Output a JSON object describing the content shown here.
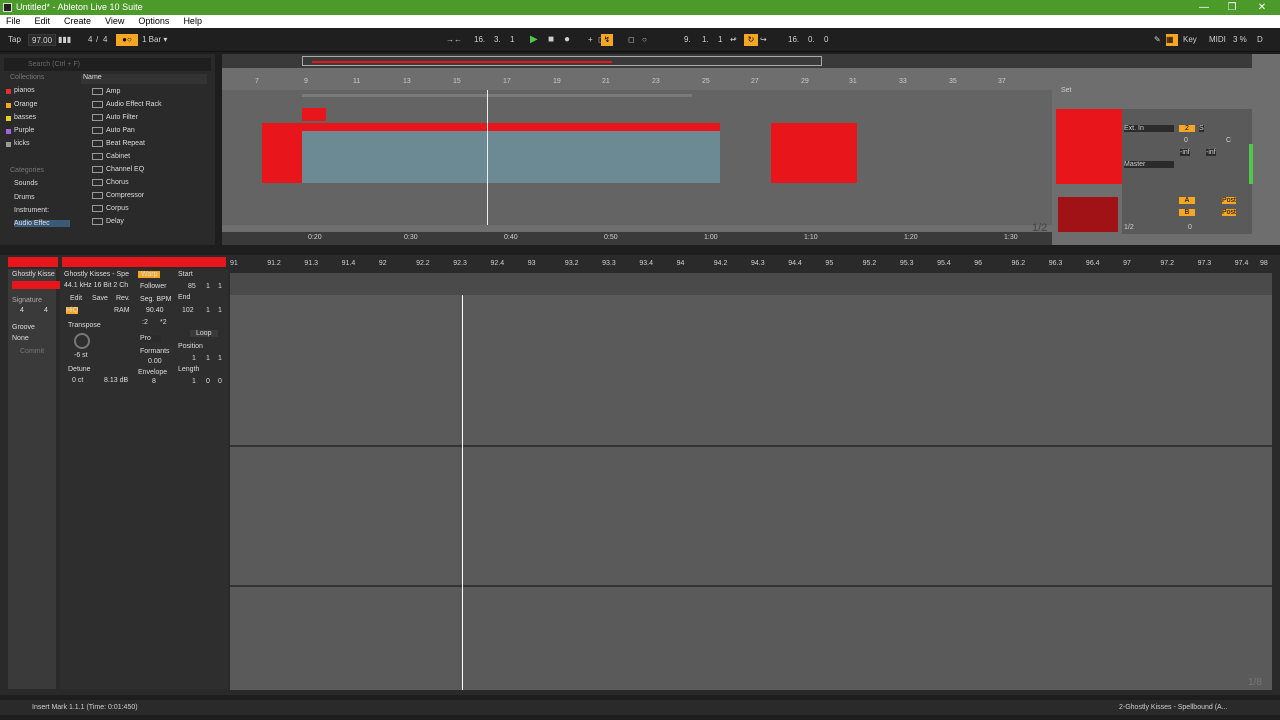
{
  "window": {
    "title": "Untitled* - Ableton Live 10 Suite"
  },
  "menu": [
    "File",
    "Edit",
    "Create",
    "View",
    "Options",
    "Help"
  ],
  "transport": {
    "tap": "Tap",
    "tempo": "97.00",
    "sig_num": "4",
    "sig_den": "4",
    "quantize": "1 Bar",
    "pos": [
      "16.",
      "3.",
      "1"
    ],
    "loop_start": [
      "9.",
      "1.",
      "1"
    ],
    "loop_len": [
      "16.",
      "0.",
      "0"
    ],
    "key": "Key",
    "midi": "MIDI",
    "cpu": "3 %",
    "disk": "D"
  },
  "browser": {
    "search_placeholder": "Search (Ctrl + F)",
    "collections_title": "Collections",
    "collections": [
      {
        "label": "pianos",
        "color": "#e03030"
      },
      {
        "label": "Orange",
        "color": "#f5a623"
      },
      {
        "label": "basses",
        "color": "#e6d21a"
      },
      {
        "label": "Purple",
        "color": "#a463d6"
      },
      {
        "label": "kicks",
        "color": "#9a9a9a"
      }
    ],
    "categories_title": "Categories",
    "categories": [
      "Sounds",
      "Drums",
      "Instrument:",
      "Audio Effec"
    ],
    "name_header": "Name",
    "items": [
      "Amp",
      "Audio Effect Rack",
      "Auto Filter",
      "Auto Pan",
      "Beat Repeat",
      "Cabinet",
      "Channel EQ",
      "Chorus",
      "Compressor",
      "Corpus",
      "Delay"
    ]
  },
  "arrangement": {
    "bars": [
      "7",
      "9",
      "11",
      "13",
      "15",
      "17",
      "19",
      "21",
      "23",
      "25",
      "27",
      "29",
      "31",
      "33",
      "35",
      "37"
    ],
    "times": [
      "0:20",
      "0:30",
      "0:40",
      "0:50",
      "1:00",
      "1:10",
      "1:20",
      "1:30"
    ],
    "set_label": "Set",
    "page": "1/2",
    "mixer": {
      "input": "Ext. In",
      "master": "Master",
      "track_num": "2",
      "solo": "S",
      "vol": "0",
      "pan": "C",
      "inf1": "-inf",
      "inf2": "-inf",
      "send_a": "A",
      "send_b": "B",
      "post": "Post",
      "half": "1/2",
      "mv": "0"
    }
  },
  "clip": {
    "name": "Ghostly Kisse",
    "sample": "Ghostly Kisses - Spe",
    "format": "44.1 kHz 16 Bit 2 Ch",
    "warp": "Warp",
    "start": "Start",
    "follower": "Follower",
    "start_val": [
      "85",
      "1",
      "1"
    ],
    "end": "End",
    "end_val": [
      "102",
      "1",
      "1"
    ],
    "edit": "Edit",
    "save": "Save",
    "rev": "Rev.",
    "hiq": "HiQ",
    "ram": "RAM",
    "seg_bpm": "Seg. BPM",
    "seg_val": "90.40",
    "half": ":2",
    "dbl": "*2",
    "mode": "Pro",
    "formants": "Formants",
    "formants_val": "0.00",
    "envelope": "Envelope",
    "envelope_val": "8",
    "loop": "Loop",
    "position": "Position",
    "pos_val": [
      "1",
      "1",
      "1"
    ],
    "length": "Length",
    "len_val": [
      "1",
      "0",
      "0"
    ],
    "signature": "Signature",
    "sig": [
      "4",
      "4"
    ],
    "groove": "Groove",
    "groove_val": "None",
    "commit": "Commit",
    "transpose": "Transpose",
    "transpose_val": "-6 st",
    "detune": "Detune",
    "detune_val": "0 ct",
    "gain_val": "8.13 dB",
    "page": "1/8"
  },
  "clip_ruler": [
    "91",
    "91.2",
    "91.3",
    "91.4",
    "92",
    "92.2",
    "92.3",
    "92.4",
    "93",
    "93.2",
    "93.3",
    "93.4",
    "94",
    "94.2",
    "94.3",
    "94.4",
    "95",
    "95.2",
    "95.3",
    "95.4",
    "96",
    "96.2",
    "96.3",
    "96.4",
    "97",
    "97.2",
    "97.3",
    "97.4",
    "98"
  ],
  "status": {
    "message": "Insert Mark 1.1.1 (Time: 0:01:450)",
    "track": "2-Ghostly Kisses - Spellbound (A..."
  },
  "colors": {
    "accent": "#f5a623",
    "clip_red": "#e8161b",
    "wave_bg": "#5a5a5a",
    "title_green": "#4c9a2a"
  }
}
